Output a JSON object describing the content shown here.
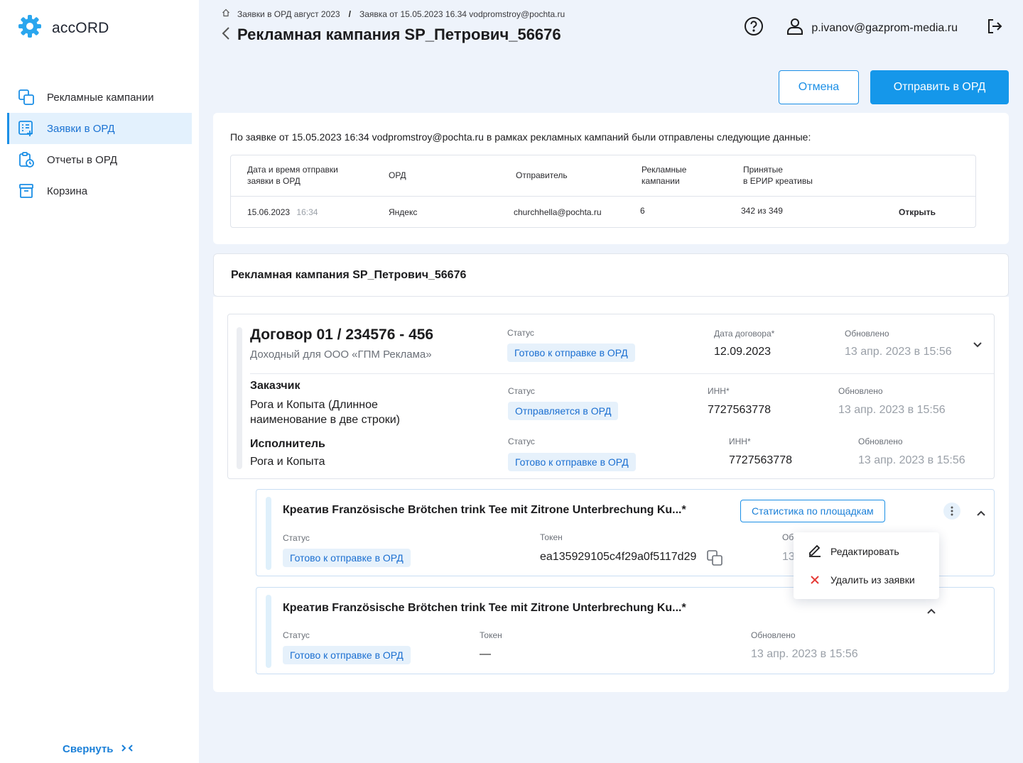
{
  "app": {
    "name": "accORD"
  },
  "sidebar": {
    "items": [
      {
        "label": "Рекламные кампании",
        "icon": "copy-icon",
        "active": false
      },
      {
        "label": "Заявки в ОРД",
        "icon": "list-add-icon",
        "active": true
      },
      {
        "label": "Отчеты в ОРД",
        "icon": "clipboard-clock-icon",
        "active": false
      },
      {
        "label": "Корзина",
        "icon": "archive-icon",
        "active": false
      }
    ],
    "collapse_label": "Свернуть"
  },
  "header": {
    "breadcrumb": [
      "Заявки в ОРД август 2023",
      "Заявка от 15.05.2023 16.34 vodpromstroy@pochta.ru"
    ],
    "title": "Рекламная кампания SP_Петрович_56676",
    "user_email": "p.ivanov@gazprom-media.ru"
  },
  "actions": {
    "cancel": "Отмена",
    "send": "Отправить в ОРД"
  },
  "info": {
    "text": "По заявке от 15.05.2023 16:34 vodpromstroy@pochta.ru в рамках рекламных кампаний были отправлены следующие данные:",
    "columns": [
      "Дата и время отправки\nзаявки в ОРД",
      "ОРД",
      "Отправитель",
      "Рекламные\nкампании",
      "Принятые\nв ЕРИР креативы"
    ],
    "row": {
      "date": "15.06.2023",
      "time": "16:34",
      "ord": "Яндекс",
      "sender": "churchhella@pochta.ru",
      "campaigns": "6",
      "accepted": "342 из 349",
      "action": "Открыть"
    }
  },
  "campaign": {
    "title": "Рекламная кампания SP_Петрович_56676"
  },
  "contract": {
    "title": "Договор 01 / 234576 - 456",
    "subtitle": "Доходный для ООО «ГПМ Реклама»",
    "status_label": "Статус",
    "status": "Готово к отправке в ОРД",
    "date_label": "Дата договора*",
    "date": "12.09.2023",
    "updated_label": "Обновлено",
    "updated": "13 апр. 2023 в 15:56",
    "customer": {
      "role": "Заказчик",
      "name": "Рога и Копыта (Длинное наименование в две строки)",
      "status_label": "Статус",
      "status": "Отправляется в ОРД",
      "inn_label": "ИНН*",
      "inn": "7727563778",
      "updated_label": "Обновлено",
      "updated": "13 апр. 2023 в 15:56"
    },
    "executor": {
      "role": "Исполнитель",
      "name": "Рога и Копыта",
      "status_label": "Статус",
      "status": "Готово к отправке в ОРД",
      "inn_label": "ИНН*",
      "inn": "7727563778",
      "updated_label": "Обновлено",
      "updated": "13 апр. 2023 в 15:56"
    }
  },
  "creatives": [
    {
      "title": "Креатив Französische Brötchen trink Tee mit Zitrone Unterbrechung Ku...*",
      "stats_button": "Статистика по площадкам",
      "status_label": "Статус",
      "status": "Готово к отправке в ОРД",
      "token_label": "Токен",
      "token": "ea135929105c4f29a0f5117d29",
      "updated_label_partial": "Об",
      "updated_partial": "13"
    },
    {
      "title": "Креатив Französische Brötchen trink Tee mit Zitrone Unterbrechung Ku...*",
      "status_label": "Статус",
      "status": "Готово к отправке в ОРД",
      "token_label": "Токен",
      "token": "—",
      "updated_label": "Обновлено",
      "updated": "13 апр. 2023 в 15:56"
    }
  ],
  "menu": {
    "edit": "Редактировать",
    "delete": "Удалить из заявки"
  },
  "colors": {
    "accent": "#1597ea",
    "badge_bg": "#e6f1fb",
    "badge_text": "#1b6fd1",
    "page_bg": "#eef3fb",
    "delete": "#e53935"
  }
}
